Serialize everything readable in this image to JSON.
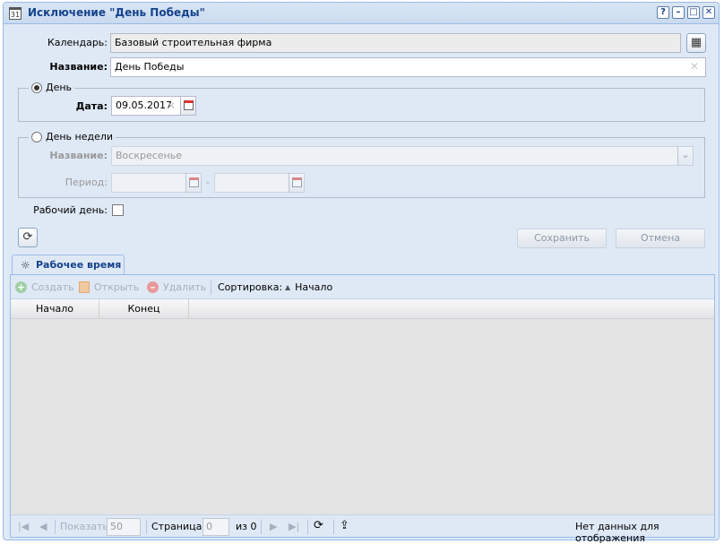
{
  "window": {
    "title": "Исключение \"День Победы\"",
    "title_icon_text": "31",
    "tools": [
      "?",
      "–",
      "□",
      "✕"
    ]
  },
  "form": {
    "calendar_label": "Календарь:",
    "calendar_value": "Базовый строительная фирма",
    "name_label": "Название:",
    "name_value": "День Победы",
    "day_group": {
      "legend": "День",
      "selected": true,
      "date_label": "Дата:",
      "date_value": "09.05.2017"
    },
    "weekday_group": {
      "legend": "День недели",
      "selected": false,
      "name_label": "Название:",
      "name_value": "Воскресенье",
      "period_label": "Период:",
      "period_separator": "-"
    },
    "workday_label": "Рабочий день:",
    "workday_checked": false,
    "save_label": "Сохранить",
    "cancel_label": "Отмена"
  },
  "tab": {
    "label": "Рабочее время"
  },
  "toolbar": {
    "create_label": "Создать",
    "open_label": "Открыть",
    "delete_label": "Удалить",
    "sort_label": "Сортировка:",
    "sort_value": "Начало"
  },
  "grid": {
    "columns": [
      "Начало",
      "Конец"
    ]
  },
  "pager": {
    "show_label": "Показать",
    "page_size": "50",
    "page_label": "Страница",
    "page_value": "0",
    "of_label": "из 0",
    "status": "Нет данных для отображения"
  }
}
